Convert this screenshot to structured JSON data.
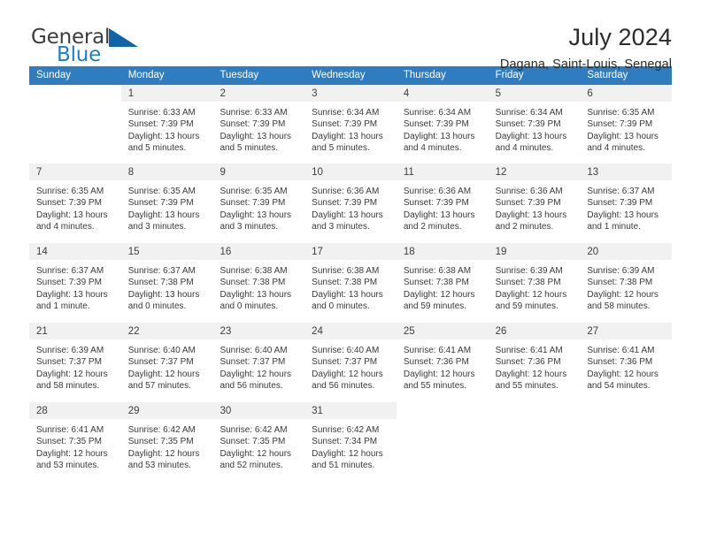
{
  "brand": {
    "name_top": "General",
    "name_bottom": "Blue",
    "triangle_color": "#1064a8",
    "blue": "#1f7ec4"
  },
  "header": {
    "title": "July 2024",
    "subtitle": "Dagana, Saint-Louis, Senegal"
  },
  "theme": {
    "header_blue": "#2f7dc0",
    "daynum_band": "#f1f1f1",
    "text": "#3a3a3a"
  },
  "calendar": {
    "weekdays": [
      "Sunday",
      "Monday",
      "Tuesday",
      "Wednesday",
      "Thursday",
      "Friday",
      "Saturday"
    ],
    "weeks": [
      [
        {
          "day": "",
          "lines": []
        },
        {
          "day": "1",
          "lines": [
            "Sunrise: 6:33 AM",
            "Sunset: 7:39 PM",
            "Daylight: 13 hours",
            "and 5 minutes."
          ]
        },
        {
          "day": "2",
          "lines": [
            "Sunrise: 6:33 AM",
            "Sunset: 7:39 PM",
            "Daylight: 13 hours",
            "and 5 minutes."
          ]
        },
        {
          "day": "3",
          "lines": [
            "Sunrise: 6:34 AM",
            "Sunset: 7:39 PM",
            "Daylight: 13 hours",
            "and 5 minutes."
          ]
        },
        {
          "day": "4",
          "lines": [
            "Sunrise: 6:34 AM",
            "Sunset: 7:39 PM",
            "Daylight: 13 hours",
            "and 4 minutes."
          ]
        },
        {
          "day": "5",
          "lines": [
            "Sunrise: 6:34 AM",
            "Sunset: 7:39 PM",
            "Daylight: 13 hours",
            "and 4 minutes."
          ]
        },
        {
          "day": "6",
          "lines": [
            "Sunrise: 6:35 AM",
            "Sunset: 7:39 PM",
            "Daylight: 13 hours",
            "and 4 minutes."
          ]
        }
      ],
      [
        {
          "day": "7",
          "lines": [
            "Sunrise: 6:35 AM",
            "Sunset: 7:39 PM",
            "Daylight: 13 hours",
            "and 4 minutes."
          ]
        },
        {
          "day": "8",
          "lines": [
            "Sunrise: 6:35 AM",
            "Sunset: 7:39 PM",
            "Daylight: 13 hours",
            "and 3 minutes."
          ]
        },
        {
          "day": "9",
          "lines": [
            "Sunrise: 6:35 AM",
            "Sunset: 7:39 PM",
            "Daylight: 13 hours",
            "and 3 minutes."
          ]
        },
        {
          "day": "10",
          "lines": [
            "Sunrise: 6:36 AM",
            "Sunset: 7:39 PM",
            "Daylight: 13 hours",
            "and 3 minutes."
          ]
        },
        {
          "day": "11",
          "lines": [
            "Sunrise: 6:36 AM",
            "Sunset: 7:39 PM",
            "Daylight: 13 hours",
            "and 2 minutes."
          ]
        },
        {
          "day": "12",
          "lines": [
            "Sunrise: 6:36 AM",
            "Sunset: 7:39 PM",
            "Daylight: 13 hours",
            "and 2 minutes."
          ]
        },
        {
          "day": "13",
          "lines": [
            "Sunrise: 6:37 AM",
            "Sunset: 7:39 PM",
            "Daylight: 13 hours",
            "and 1 minute."
          ]
        }
      ],
      [
        {
          "day": "14",
          "lines": [
            "Sunrise: 6:37 AM",
            "Sunset: 7:39 PM",
            "Daylight: 13 hours",
            "and 1 minute."
          ]
        },
        {
          "day": "15",
          "lines": [
            "Sunrise: 6:37 AM",
            "Sunset: 7:38 PM",
            "Daylight: 13 hours",
            "and 0 minutes."
          ]
        },
        {
          "day": "16",
          "lines": [
            "Sunrise: 6:38 AM",
            "Sunset: 7:38 PM",
            "Daylight: 13 hours",
            "and 0 minutes."
          ]
        },
        {
          "day": "17",
          "lines": [
            "Sunrise: 6:38 AM",
            "Sunset: 7:38 PM",
            "Daylight: 13 hours",
            "and 0 minutes."
          ]
        },
        {
          "day": "18",
          "lines": [
            "Sunrise: 6:38 AM",
            "Sunset: 7:38 PM",
            "Daylight: 12 hours",
            "and 59 minutes."
          ]
        },
        {
          "day": "19",
          "lines": [
            "Sunrise: 6:39 AM",
            "Sunset: 7:38 PM",
            "Daylight: 12 hours",
            "and 59 minutes."
          ]
        },
        {
          "day": "20",
          "lines": [
            "Sunrise: 6:39 AM",
            "Sunset: 7:38 PM",
            "Daylight: 12 hours",
            "and 58 minutes."
          ]
        }
      ],
      [
        {
          "day": "21",
          "lines": [
            "Sunrise: 6:39 AM",
            "Sunset: 7:37 PM",
            "Daylight: 12 hours",
            "and 58 minutes."
          ]
        },
        {
          "day": "22",
          "lines": [
            "Sunrise: 6:40 AM",
            "Sunset: 7:37 PM",
            "Daylight: 12 hours",
            "and 57 minutes."
          ]
        },
        {
          "day": "23",
          "lines": [
            "Sunrise: 6:40 AM",
            "Sunset: 7:37 PM",
            "Daylight: 12 hours",
            "and 56 minutes."
          ]
        },
        {
          "day": "24",
          "lines": [
            "Sunrise: 6:40 AM",
            "Sunset: 7:37 PM",
            "Daylight: 12 hours",
            "and 56 minutes."
          ]
        },
        {
          "day": "25",
          "lines": [
            "Sunrise: 6:41 AM",
            "Sunset: 7:36 PM",
            "Daylight: 12 hours",
            "and 55 minutes."
          ]
        },
        {
          "day": "26",
          "lines": [
            "Sunrise: 6:41 AM",
            "Sunset: 7:36 PM",
            "Daylight: 12 hours",
            "and 55 minutes."
          ]
        },
        {
          "day": "27",
          "lines": [
            "Sunrise: 6:41 AM",
            "Sunset: 7:36 PM",
            "Daylight: 12 hours",
            "and 54 minutes."
          ]
        }
      ],
      [
        {
          "day": "28",
          "lines": [
            "Sunrise: 6:41 AM",
            "Sunset: 7:35 PM",
            "Daylight: 12 hours",
            "and 53 minutes."
          ]
        },
        {
          "day": "29",
          "lines": [
            "Sunrise: 6:42 AM",
            "Sunset: 7:35 PM",
            "Daylight: 12 hours",
            "and 53 minutes."
          ]
        },
        {
          "day": "30",
          "lines": [
            "Sunrise: 6:42 AM",
            "Sunset: 7:35 PM",
            "Daylight: 12 hours",
            "and 52 minutes."
          ]
        },
        {
          "day": "31",
          "lines": [
            "Sunrise: 6:42 AM",
            "Sunset: 7:34 PM",
            "Daylight: 12 hours",
            "and 51 minutes."
          ]
        },
        {
          "day": "",
          "lines": []
        },
        {
          "day": "",
          "lines": []
        },
        {
          "day": "",
          "lines": []
        }
      ]
    ]
  }
}
